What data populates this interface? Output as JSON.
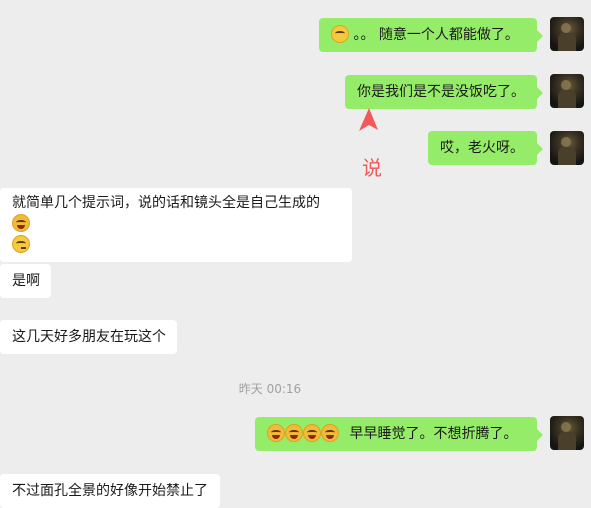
{
  "messages": [
    {
      "text": "。。 随意一个人都能做了。"
    },
    {
      "text": "你是我们是不是没饭吃了。"
    },
    {
      "text": "哎，老火呀。"
    },
    {
      "text": "就简单几个提示词，说的话和镜头全是自己生成的"
    },
    {
      "text": "是啊"
    },
    {
      "text": "这几天好多朋友在玩这个"
    },
    {
      "text": "早早睡觉了。不想折腾了。"
    },
    {
      "text": "不过面孔全景的好像开始禁止了"
    }
  ],
  "timestamp": "昨天 00:16",
  "annotation": {
    "label": "说",
    "color": "#f05a5a"
  },
  "colors": {
    "self_bubble": "#95ec69",
    "other_bubble": "#ffffff",
    "background": "#ededed"
  }
}
